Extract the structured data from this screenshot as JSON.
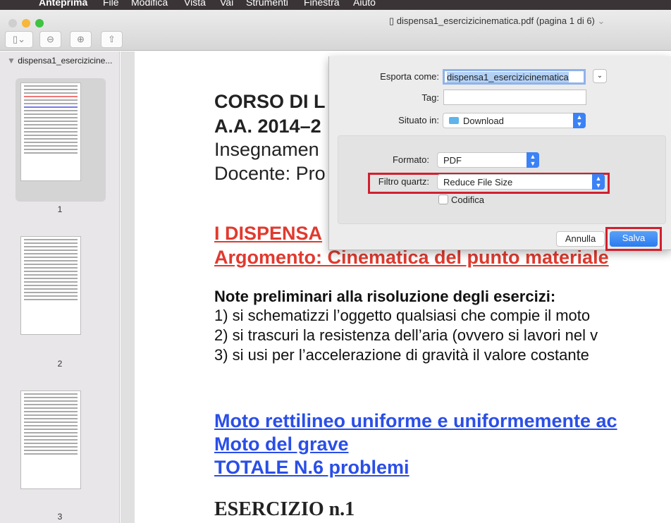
{
  "menubar": {
    "app": "Anteprima",
    "items": [
      "File",
      "Modifica",
      "Vista",
      "Vai",
      "Strumenti",
      "Finestra",
      "Aiuto"
    ]
  },
  "window": {
    "title": "dispensa1_esercizicinematica.pdf (pagina 1 di 6)"
  },
  "sidebar": {
    "doc": "dispensa1_esercizicine...",
    "pages": [
      "1",
      "2",
      "3"
    ]
  },
  "document": {
    "lines": [
      "CORSO DI L",
      "A.A. 2014–2",
      "Insegnamen",
      "Docente: Pro",
      "I DISPENSA",
      "Argomento: Cinematica del punto materiale",
      "Note preliminari alla risoluzione degli esercizi:",
      "1) si schematizzi l’oggetto qualsiasi che compie il moto",
      "2) si trascuri la resistenza dell’aria (ovvero si lavori nel v",
      "3) si usi per l’accelerazione di gravità il valore costante",
      "Moto rettilineo uniforme e uniformemente ac",
      "Moto del grave",
      "TOTALE N.6 problemi",
      "ESERCIZIO n.1"
    ]
  },
  "dialog": {
    "export_label": "Esporta come:",
    "export_value": "dispensa1_esercizicinematica",
    "tag_label": "Tag:",
    "tag_value": "",
    "where_label": "Situato in:",
    "where_value": "Download",
    "format_label": "Formato:",
    "format_value": "PDF",
    "filter_label": "Filtro quartz:",
    "filter_value": "Reduce File Size",
    "encrypt_label": "Codifica",
    "cancel": "Annulla",
    "save": "Salva"
  },
  "colors": {
    "accent": "#3b82f6",
    "highlight": "#d0202e"
  }
}
